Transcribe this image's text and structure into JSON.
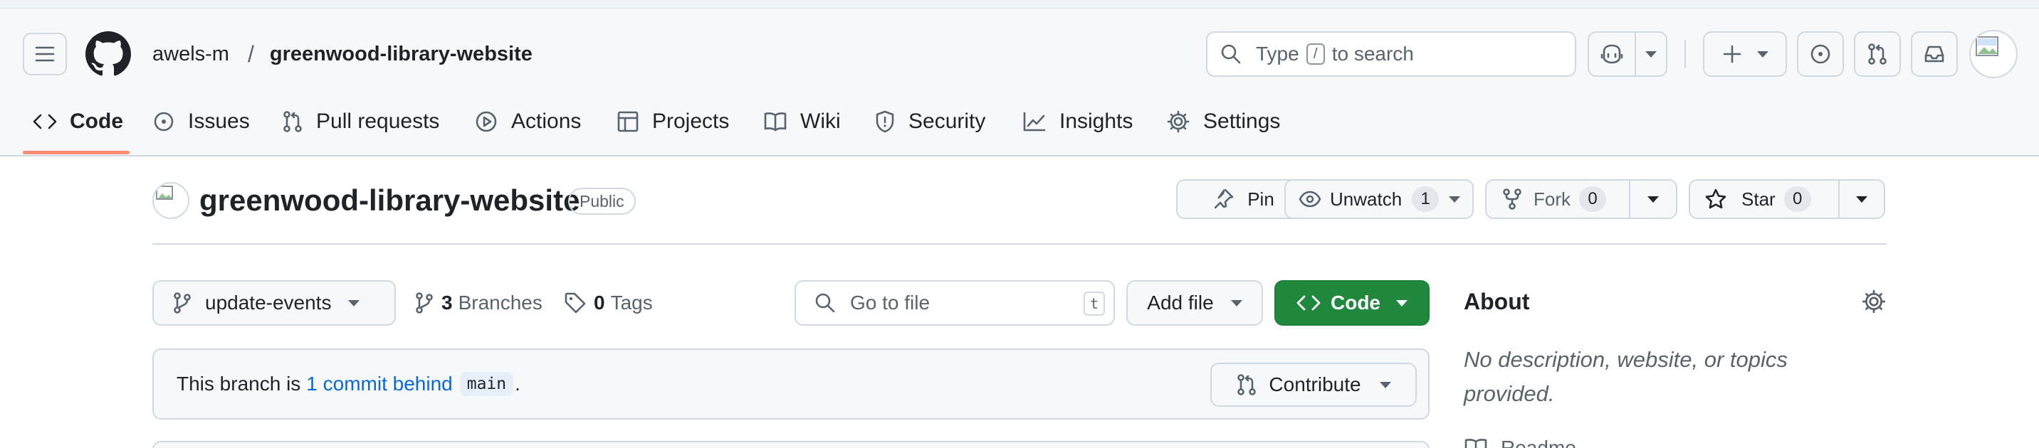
{
  "header": {
    "owner": "awels-m",
    "slash": "/",
    "repo": "greenwood-library-website",
    "search": {
      "prefix": "Type",
      "key": "/",
      "suffix": "to search"
    }
  },
  "tabs": [
    {
      "label": "Code",
      "icon": "code-icon"
    },
    {
      "label": "Issues",
      "icon": "issue-opened-icon"
    },
    {
      "label": "Pull requests",
      "icon": "git-pull-request-icon"
    },
    {
      "label": "Actions",
      "icon": "play-icon"
    },
    {
      "label": "Projects",
      "icon": "table-icon"
    },
    {
      "label": "Wiki",
      "icon": "book-icon"
    },
    {
      "label": "Security",
      "icon": "shield-icon"
    },
    {
      "label": "Insights",
      "icon": "graph-icon"
    },
    {
      "label": "Settings",
      "icon": "gear-icon"
    }
  ],
  "repo_header": {
    "name": "greenwood-library-website",
    "visibility": "Public",
    "pin_label": "Pin",
    "unwatch_label": "Unwatch",
    "watch_count": "1",
    "fork_label": "Fork",
    "fork_count": "0",
    "star_label": "Star",
    "star_count": "0"
  },
  "toolbar": {
    "branch": "update-events",
    "branches_count": "3",
    "branches_label": "Branches",
    "tags_count": "0",
    "tags_label": "Tags",
    "go_to_file_placeholder": "Go to file",
    "go_to_file_key": "t",
    "add_file_label": "Add file",
    "code_label": "Code"
  },
  "branch_notice": {
    "prefix": "This branch is",
    "link": "1 commit behind",
    "base_branch": "main",
    "suffix": ".",
    "contribute_label": "Contribute"
  },
  "about": {
    "title": "About",
    "description": "No description, website, or topics provided.",
    "readme_label": "Readme"
  },
  "colors": {
    "accent_underline": "#fd8c73",
    "code_button": "#1f883d",
    "link": "#0969da"
  }
}
